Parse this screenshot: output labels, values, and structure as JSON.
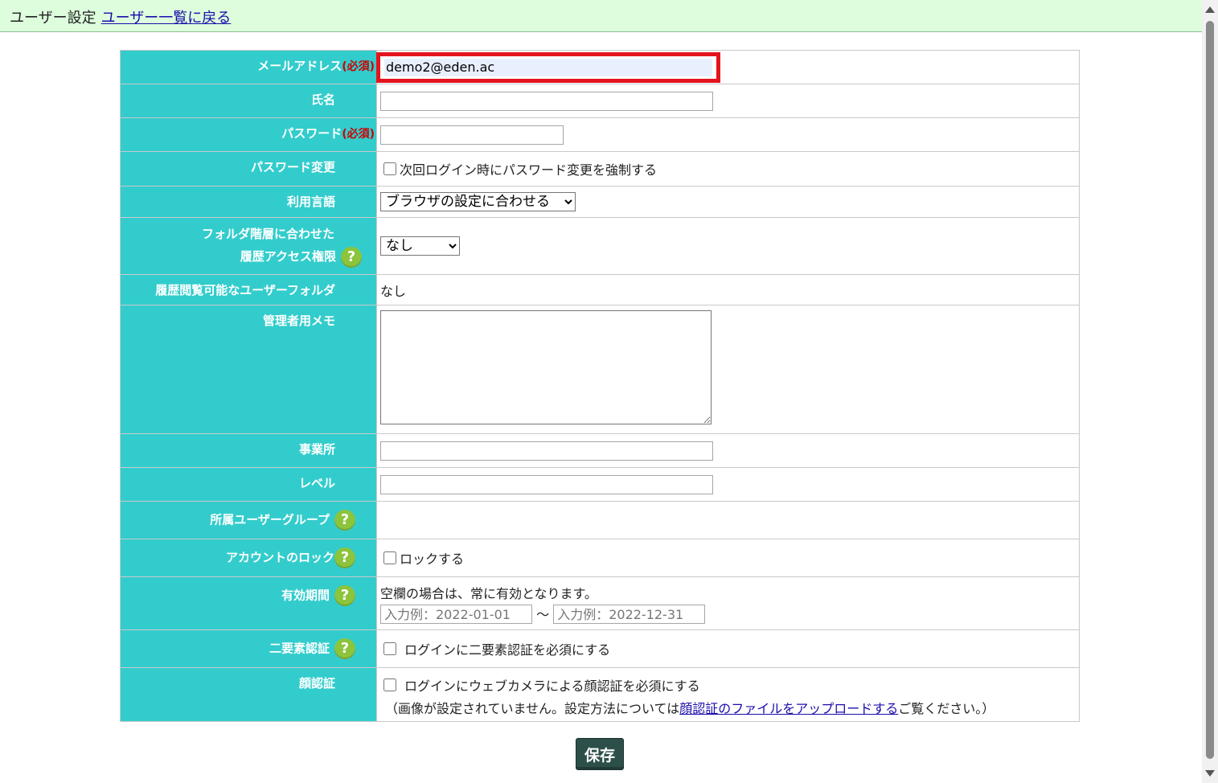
{
  "header": {
    "title": "ユーザー設定",
    "back_link": "ユーザー一覧に戻る"
  },
  "form": {
    "email": {
      "label": "メールアドレス",
      "required": "(必須)",
      "value": "demo2@eden.ac"
    },
    "name": {
      "label": "氏名",
      "value": ""
    },
    "password": {
      "label": "パスワード",
      "required": "(必須)",
      "value": ""
    },
    "password_change": {
      "label": "パスワード変更",
      "checkbox_label": "次回ログイン時にパスワード変更を強制する"
    },
    "language": {
      "label": "利用言語",
      "selected": "ブラウザの設定に合わせる"
    },
    "folder_access": {
      "label_line1": "フォルダ階層に合わせた",
      "label_line2": "履歴アクセス権限",
      "selected": "なし"
    },
    "history_folder": {
      "label": "履歴閲覧可能なユーザーフォルダ",
      "value": "なし"
    },
    "admin_memo": {
      "label": "管理者用メモ",
      "value": ""
    },
    "office": {
      "label": "事業所",
      "value": ""
    },
    "level": {
      "label": "レベル",
      "value": ""
    },
    "user_group": {
      "label": "所属ユーザーグループ"
    },
    "account_lock": {
      "label": "アカウントのロック",
      "checkbox_label": "ロックする"
    },
    "validity": {
      "label": "有効期間",
      "note": "空欄の場合は、常に有効となります。",
      "start_placeholder": "入力例：2022-01-01",
      "separator": "～",
      "end_placeholder": "入力例：2022-12-31"
    },
    "two_factor": {
      "label": "二要素認証",
      "checkbox_label": "ログインに二要素認証を必須にする"
    },
    "face_auth": {
      "label": "顔認証",
      "checkbox_label": "ログインにウェブカメラによる顔認証を必須にする",
      "note_prefix": "（画像が設定されていません。設定方法については",
      "note_link": "顔認証のファイルをアップロードする",
      "note_suffix": "ご覧ください。）"
    },
    "help_symbol": "?"
  },
  "actions": {
    "save_label": "保存"
  },
  "colors": {
    "label_bg": "#33cccc",
    "header_bg": "#ddfddd",
    "highlight": "#e4141e",
    "help": "#8cc43c",
    "save_bg": "#2d4f4a"
  },
  "icons": {
    "help": "help-icon"
  }
}
